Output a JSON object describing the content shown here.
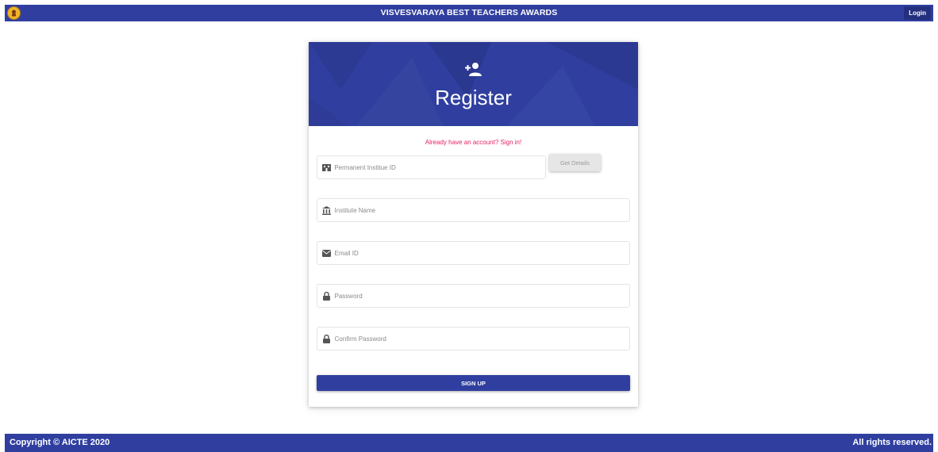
{
  "header": {
    "title": "VISVESVARAYA BEST TEACHERS AWARDS",
    "login_label": "Login",
    "logo_icon": "emblem-icon"
  },
  "register_card": {
    "title": "Register",
    "header_icon": "add-person-icon",
    "signin_text": "Already have an account? Sign in!",
    "fields": {
      "institute_id": {
        "placeholder": "Permanent Institue ID",
        "icon": "building-icon",
        "value": ""
      },
      "institute_name": {
        "placeholder": "Institute Name",
        "icon": "bank-icon",
        "value": ""
      },
      "email": {
        "placeholder": "Email ID",
        "icon": "envelope-icon",
        "value": ""
      },
      "password": {
        "placeholder": "Password",
        "icon": "lock-icon",
        "value": ""
      },
      "confirm_password": {
        "placeholder": "Confirm Password",
        "icon": "lock-icon",
        "value": ""
      }
    },
    "get_details_label": "Get Details",
    "signup_label": "SIGN UP"
  },
  "footer": {
    "copyright": "Copyright © AICTE 2020",
    "rights": "All rights reserved."
  },
  "colors": {
    "primary": "#303f9f",
    "link": "#e91e63",
    "background": "#ffffff"
  }
}
